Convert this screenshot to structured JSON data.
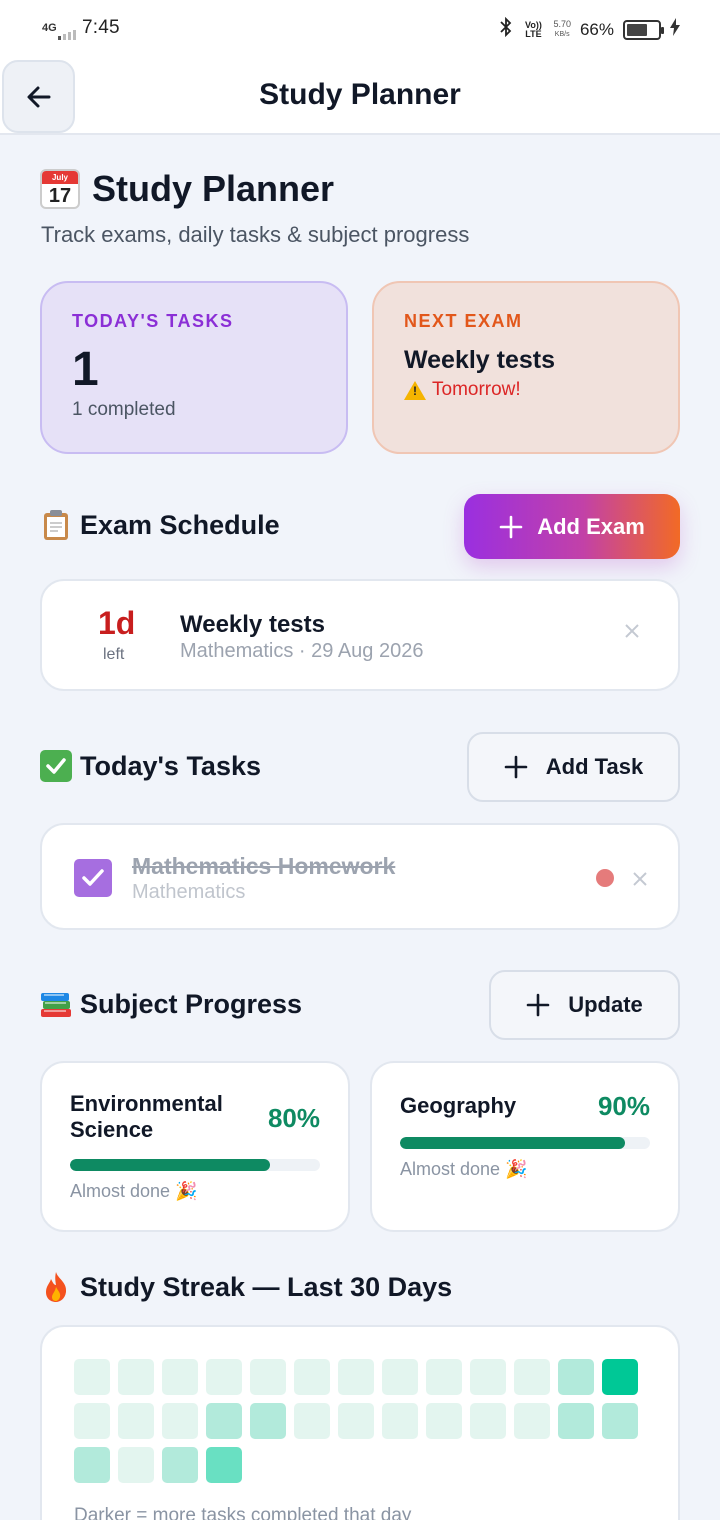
{
  "status": {
    "network": "4G",
    "time": "7:45",
    "volte": "Vo)) LTE",
    "speed_top": "5.70",
    "speed_bottom": "KB/s",
    "battery": "66%",
    "battery_level": 0.66
  },
  "appbar": {
    "title": "Study Planner"
  },
  "header": {
    "calendar_month": "July",
    "calendar_day": "17",
    "title": "Study Planner",
    "subtitle": "Track exams, daily tasks & subject progress"
  },
  "stats": {
    "tasks_label": "TODAY'S TASKS",
    "tasks_count": "1",
    "tasks_completed": "1 completed",
    "exam_label": "NEXT EXAM",
    "exam_name": "Weekly tests",
    "exam_when": "Tomorrow!"
  },
  "exams": {
    "title": "Exam Schedule",
    "add_label": "Add Exam",
    "items": [
      {
        "days": "1d",
        "days_label": "left",
        "name": "Weekly tests",
        "meta": "Mathematics · 29 Aug 2026"
      }
    ]
  },
  "tasks": {
    "title": "Today's Tasks",
    "add_label": "Add Task",
    "items": [
      {
        "title": "Mathematics Homework",
        "subject": "Mathematics",
        "done": true
      }
    ]
  },
  "subjects": {
    "title": "Subject Progress",
    "update_label": "Update",
    "items": [
      {
        "name": "Environmental Science",
        "percent": "80%",
        "progress": 0.8,
        "note": "Almost done 🎉"
      },
      {
        "name": "Geography",
        "percent": "90%",
        "progress": 0.9,
        "note": "Almost done 🎉"
      }
    ]
  },
  "streak": {
    "title": "Study Streak — Last 30 Days",
    "levels": [
      0,
      0,
      0,
      0,
      0,
      0,
      0,
      0,
      0,
      0,
      0,
      1,
      3,
      0,
      0,
      0,
      1,
      1,
      0,
      0,
      0,
      0,
      0,
      0,
      1,
      1,
      1,
      0,
      1,
      2
    ],
    "note": "Darker = more tasks completed that day"
  },
  "colors": {
    "accent_purple": "#8b2fd6",
    "accent_orange": "#e2571b",
    "progress_green": "#0e8a62",
    "streak_levels": [
      "#e3f5ef",
      "#b2eadb",
      "#69e0c2",
      "#00c896"
    ]
  }
}
